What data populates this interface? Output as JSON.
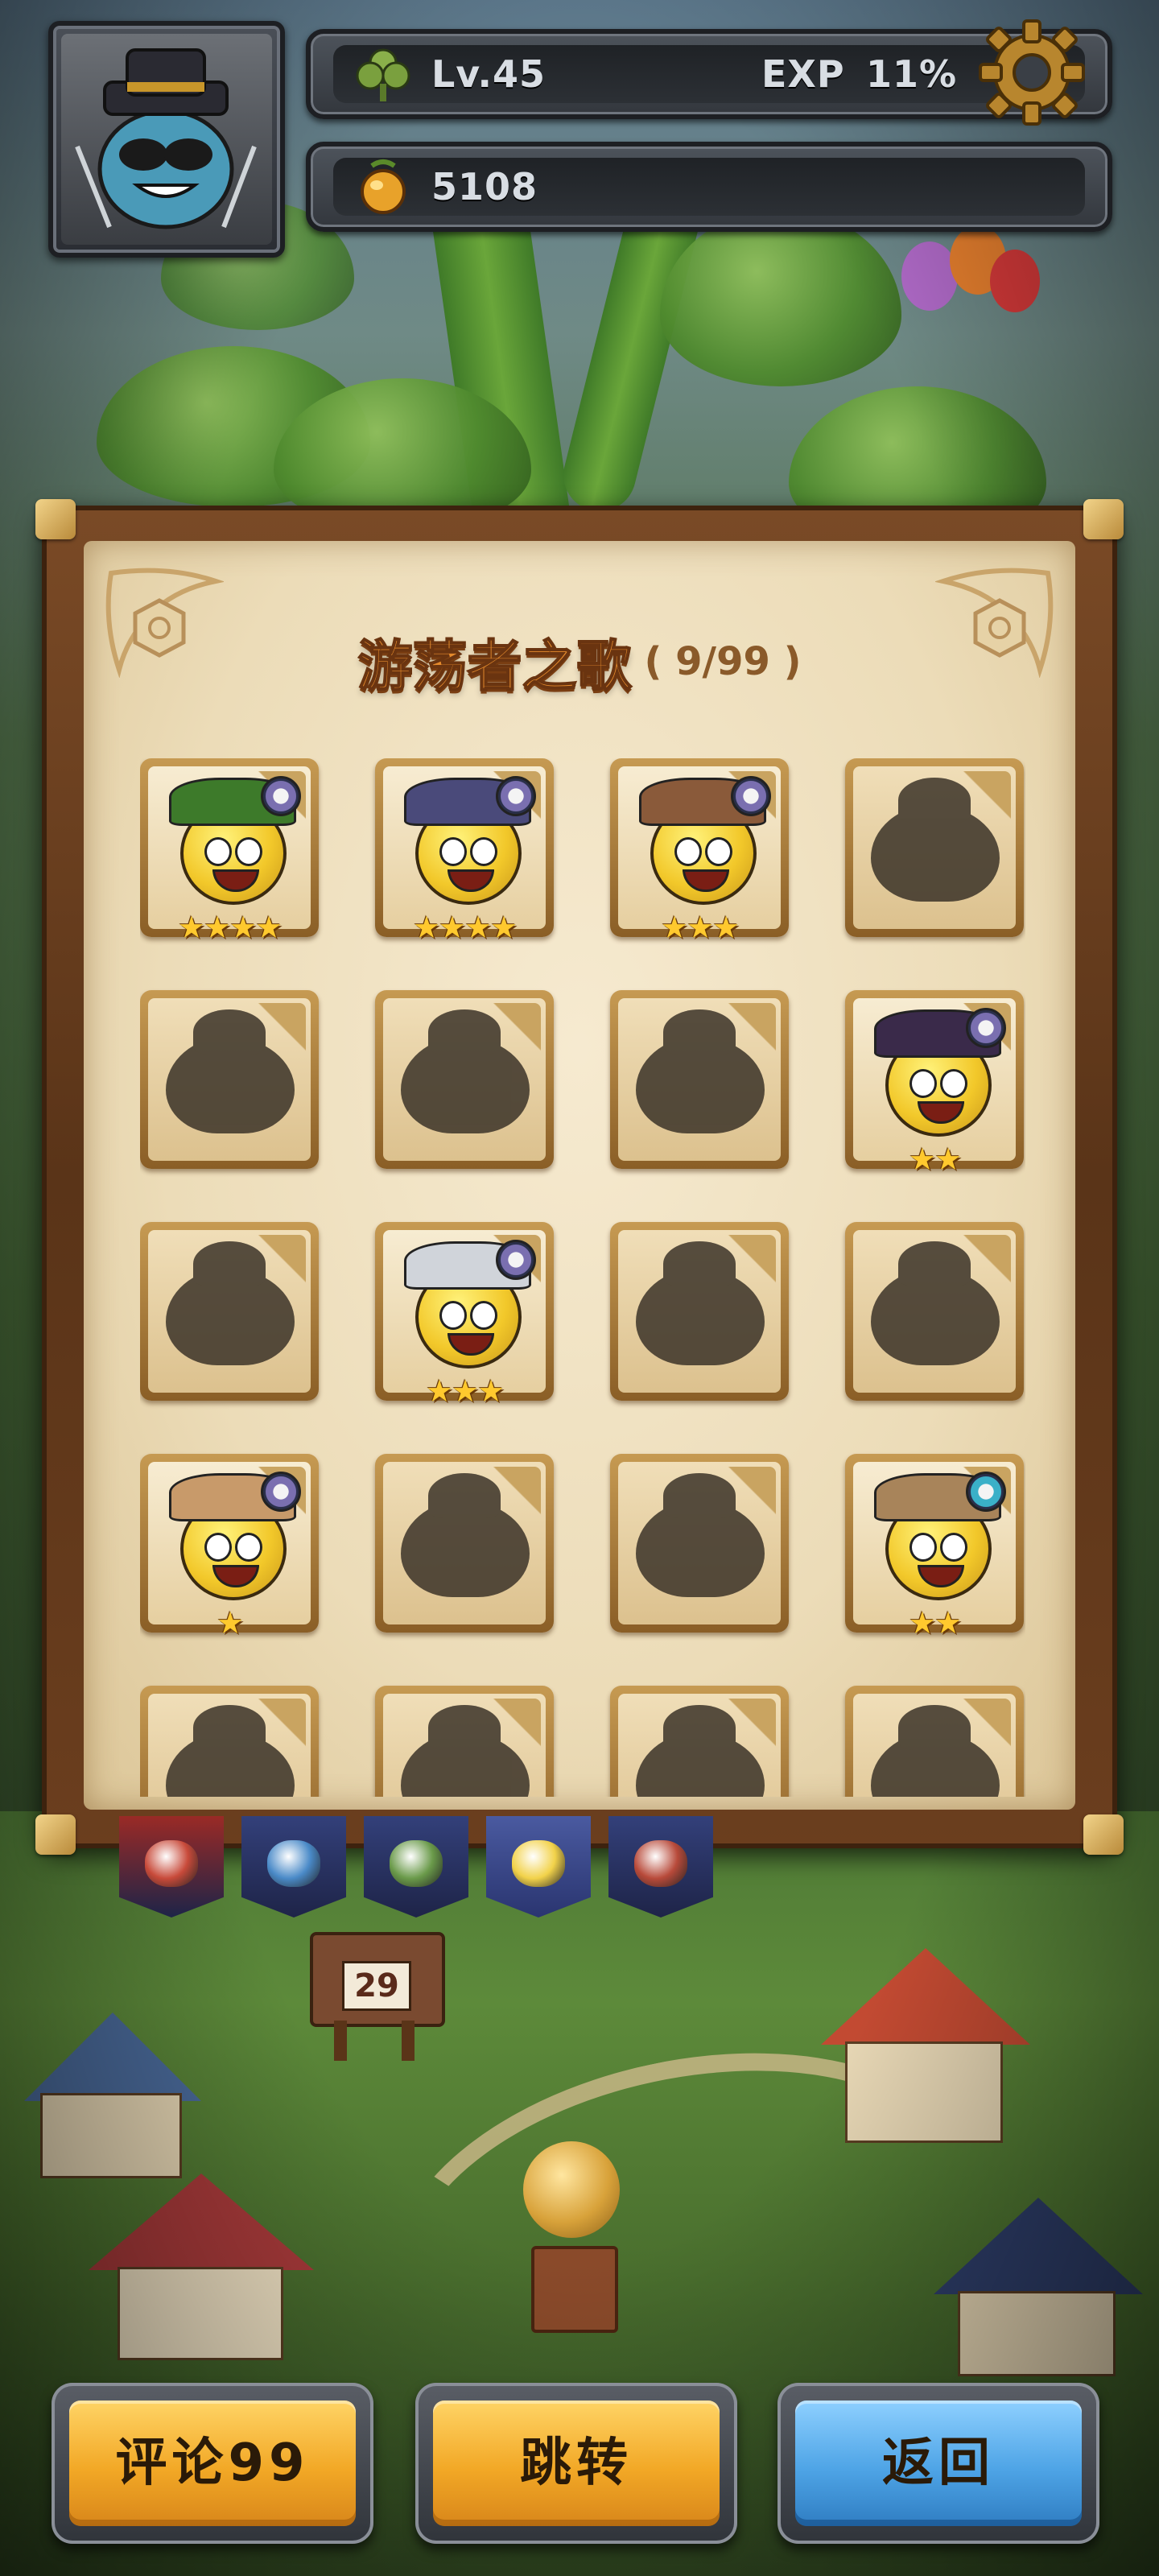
{
  "hud": {
    "level": "Lv.45",
    "exp_label": "EXP",
    "exp_value": "11%",
    "coins": "5108"
  },
  "collection": {
    "title": "游荡者之歌",
    "count": "( 9/99 )",
    "cells": [
      {
        "unlocked": true,
        "stars": "★★★★",
        "hat_color": "#3d7a2a",
        "badge_color": "#7a6fb0"
      },
      {
        "unlocked": true,
        "stars": "★★★★",
        "hat_color": "#4a4a7a",
        "badge_color": "#7a6fb0"
      },
      {
        "unlocked": true,
        "stars": "★★★",
        "hat_color": "#8a5a3a",
        "badge_color": "#7a6fb0"
      },
      {
        "unlocked": false,
        "stars": ""
      },
      {
        "unlocked": false,
        "stars": ""
      },
      {
        "unlocked": false,
        "stars": ""
      },
      {
        "unlocked": false,
        "stars": ""
      },
      {
        "unlocked": true,
        "stars": "★★",
        "hat_color": "#3a2a4a",
        "badge_color": "#7a6fb0"
      },
      {
        "unlocked": false,
        "stars": ""
      },
      {
        "unlocked": true,
        "stars": "★★★",
        "hat_color": "#d0d4da",
        "badge_color": "#7a6fb0"
      },
      {
        "unlocked": false,
        "stars": ""
      },
      {
        "unlocked": false,
        "stars": ""
      },
      {
        "unlocked": true,
        "stars": "★",
        "hat_color": "#c89a6a",
        "badge_color": "#7a6fb0"
      },
      {
        "unlocked": false,
        "stars": ""
      },
      {
        "unlocked": false,
        "stars": ""
      },
      {
        "unlocked": true,
        "stars": "★★",
        "hat_color": "#a8845a",
        "badge_color": "#3ab0c8"
      },
      {
        "unlocked": false,
        "stars": ""
      },
      {
        "unlocked": false,
        "stars": ""
      },
      {
        "unlocked": false,
        "stars": ""
      },
      {
        "unlocked": false,
        "stars": ""
      }
    ]
  },
  "tabs": [
    {
      "name": "tab-red",
      "color": "#9a2a26",
      "active": false
    },
    {
      "name": "tab-blue",
      "color": "#33407a",
      "active": false
    },
    {
      "name": "tab-green",
      "color": "#33407a",
      "active": false
    },
    {
      "name": "tab-yellow",
      "color": "#4a5aa0",
      "active": true
    },
    {
      "name": "tab-purple",
      "color": "#33407a",
      "active": false
    }
  ],
  "signpost_number": "29",
  "buttons": {
    "comments": "评论99",
    "jump": "跳转",
    "back": "返回"
  },
  "colors": {
    "title": "#e48a2c",
    "star": "#ffc92e",
    "button_orange": "#f2a826",
    "button_blue": "#4ea4e6"
  }
}
